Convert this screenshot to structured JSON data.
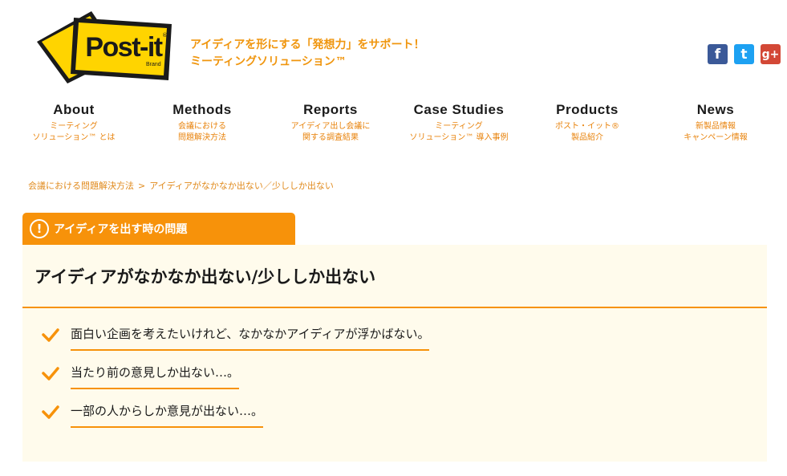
{
  "header": {
    "logo": {
      "name": "Post-it",
      "brand": "Brand",
      "colors": {
        "yellow": "#ffd400",
        "black": "#1a1a1a"
      }
    },
    "tagline": [
      "アイディアを形にする「発想力」をサポート！",
      "ミーティングソリューション™"
    ],
    "social": [
      {
        "icon": "facebook-icon",
        "glyph": "f",
        "color": "#3b5998"
      },
      {
        "icon": "twitter-icon",
        "glyph": "t",
        "color": "#1da1f2"
      },
      {
        "icon": "google-plus-icon",
        "glyph": "g+",
        "color": "#d34836"
      }
    ]
  },
  "nav": [
    {
      "title": "About",
      "sub": [
        "ミーティング",
        "ソリューション™ とは"
      ]
    },
    {
      "title": "Methods",
      "sub": [
        "会議における",
        "問題解決方法"
      ]
    },
    {
      "title": "Reports",
      "sub": [
        "アイディア出し会議に",
        "関する調査結果"
      ]
    },
    {
      "title": "Case Studies",
      "sub": [
        "ミーティング",
        "ソリューション™ 導入事例"
      ]
    },
    {
      "title": "Products",
      "sub": [
        "ポスト・イット®",
        "製品紹介"
      ]
    },
    {
      "title": "News",
      "sub": [
        "新製品情報",
        "キャンペーン情報"
      ]
    }
  ],
  "breadcrumb": {
    "items": [
      "会議における問題解決方法",
      "アイディアがなかなか出ない／少ししか出ない"
    ],
    "separator": ">"
  },
  "section": {
    "tab_label": "アイディアを出す時の問題",
    "alert_glyph": "!",
    "title": "アイディアがなかなか出ない/少ししか出ない",
    "items": [
      "面白い企画を考えたいけれど、なかなかアイディアが浮かばない。",
      "当たり前の意見しか出ない…。",
      "一部の人からしか意見が出ない…。"
    ]
  },
  "colors": {
    "accent": "#f7920a",
    "panel_bg": "#fffbec",
    "link": "#e08a1c"
  }
}
